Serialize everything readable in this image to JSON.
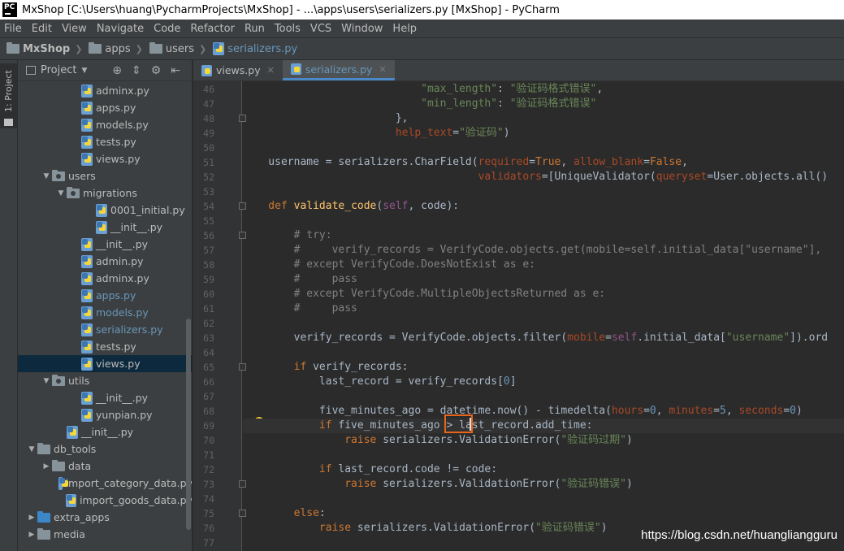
{
  "window": {
    "title": "MxShop [C:\\Users\\huang\\PycharmProjects\\MxShop] - ...\\apps\\users\\serializers.py [MxShop] - PyCharm",
    "logo_text": "PC"
  },
  "menu": [
    "File",
    "Edit",
    "View",
    "Navigate",
    "Code",
    "Refactor",
    "Run",
    "Tools",
    "VCS",
    "Window",
    "Help"
  ],
  "breadcrumb": [
    "MxShop",
    "apps",
    "users",
    "serializers.py"
  ],
  "toolwindow": {
    "label": "1: Project"
  },
  "project_panel": {
    "header": "Project",
    "icons": [
      "target-icon",
      "collapse-icon",
      "gear-icon",
      "hide-icon"
    ],
    "tree": [
      {
        "label": "adminx.py",
        "depth": 4,
        "type": "file"
      },
      {
        "label": "apps.py",
        "depth": 4,
        "type": "file"
      },
      {
        "label": "models.py",
        "depth": 4,
        "type": "file"
      },
      {
        "label": "tests.py",
        "depth": 4,
        "type": "file"
      },
      {
        "label": "views.py",
        "depth": 4,
        "type": "file"
      },
      {
        "label": "users",
        "depth": 2,
        "type": "package",
        "expanded": true
      },
      {
        "label": "migrations",
        "depth": 3,
        "type": "package",
        "expanded": true
      },
      {
        "label": "0001_initial.py",
        "depth": 5,
        "type": "file"
      },
      {
        "label": "__init__.py",
        "depth": 5,
        "type": "file"
      },
      {
        "label": "__init__.py",
        "depth": 4,
        "type": "file"
      },
      {
        "label": "admin.py",
        "depth": 4,
        "type": "file"
      },
      {
        "label": "adminx.py",
        "depth": 4,
        "type": "file"
      },
      {
        "label": "apps.py",
        "depth": 4,
        "type": "file",
        "modified": true
      },
      {
        "label": "models.py",
        "depth": 4,
        "type": "file",
        "modified": true
      },
      {
        "label": "serializers.py",
        "depth": 4,
        "type": "file",
        "modified": true
      },
      {
        "label": "tests.py",
        "depth": 4,
        "type": "file"
      },
      {
        "label": "views.py",
        "depth": 4,
        "type": "file",
        "selected": true
      },
      {
        "label": "utils",
        "depth": 2,
        "type": "package",
        "expanded": true
      },
      {
        "label": "__init__.py",
        "depth": 4,
        "type": "file"
      },
      {
        "label": "yunpian.py",
        "depth": 4,
        "type": "file"
      },
      {
        "label": "__init__.py",
        "depth": 3,
        "type": "file"
      },
      {
        "label": "db_tools",
        "depth": 1,
        "type": "folder",
        "expanded": true
      },
      {
        "label": "data",
        "depth": 2,
        "type": "folder",
        "expanded": false
      },
      {
        "label": "import_category_data.py",
        "depth": 3,
        "type": "file"
      },
      {
        "label": "import_goods_data.py",
        "depth": 3,
        "type": "file"
      },
      {
        "label": "extra_apps",
        "depth": 1,
        "type": "source-folder",
        "expanded": false
      },
      {
        "label": "media",
        "depth": 1,
        "type": "folder",
        "expanded": false
      }
    ]
  },
  "tabs": [
    {
      "label": "views.py",
      "active": false
    },
    {
      "label": "serializers.py",
      "active": true
    }
  ],
  "editor": {
    "line_numbers": [
      "46",
      "47",
      "48",
      "49",
      "50",
      "51",
      "52",
      "53",
      "54",
      "55",
      "56",
      "57",
      "58",
      "59",
      "60",
      "61",
      "62",
      "63",
      "64",
      "65",
      "66",
      "67",
      "68",
      "69",
      "70",
      "71",
      "72",
      "73",
      "74",
      "75",
      "76",
      "77"
    ],
    "lines": [
      [
        {
          "c": "str",
          "t": "                            \"max_length\""
        },
        {
          "c": "",
          "t": ": "
        },
        {
          "c": "str",
          "t": "\"验证码格式错误\""
        },
        {
          "c": "",
          "t": ","
        }
      ],
      [
        {
          "c": "str",
          "t": "                            \"min_length\""
        },
        {
          "c": "",
          "t": ": "
        },
        {
          "c": "str",
          "t": "\"验证码格式错误\""
        }
      ],
      [
        {
          "c": "",
          "t": "                        },"
        }
      ],
      [
        {
          "c": "prm",
          "t": "                        help_text"
        },
        {
          "c": "",
          "t": "="
        },
        {
          "c": "str",
          "t": "\"验证码\""
        },
        {
          "c": "",
          "t": ")"
        }
      ],
      [
        {
          "c": "",
          "t": ""
        }
      ],
      [
        {
          "c": "",
          "t": "    username = serializers.CharField("
        },
        {
          "c": "prm",
          "t": "required"
        },
        {
          "c": "",
          "t": "="
        },
        {
          "c": "kw",
          "t": "True"
        },
        {
          "c": "",
          "t": ", "
        },
        {
          "c": "prm",
          "t": "allow_blank"
        },
        {
          "c": "",
          "t": "="
        },
        {
          "c": "kw",
          "t": "False"
        },
        {
          "c": "",
          "t": ","
        }
      ],
      [
        {
          "c": "prm",
          "t": "                                     validators"
        },
        {
          "c": "",
          "t": "=[UniqueValidator("
        },
        {
          "c": "prm",
          "t": "queryset"
        },
        {
          "c": "",
          "t": "=User.objects.all()"
        }
      ],
      [
        {
          "c": "",
          "t": ""
        }
      ],
      [
        {
          "c": "kw",
          "t": "    def "
        },
        {
          "c": "fn",
          "t": "validate_code"
        },
        {
          "c": "",
          "t": "("
        },
        {
          "c": "slf",
          "t": "self"
        },
        {
          "c": "",
          "t": ", code):"
        }
      ],
      [
        {
          "c": "",
          "t": ""
        }
      ],
      [
        {
          "c": "cmt",
          "t": "        # try:"
        }
      ],
      [
        {
          "c": "cmt",
          "t": "        #     verify_records = VerifyCode.objects.get(mobile=self.initial_data[\"username\"],"
        }
      ],
      [
        {
          "c": "cmt",
          "t": "        # except VerifyCode.DoesNotExist as e:"
        }
      ],
      [
        {
          "c": "cmt",
          "t": "        #     pass"
        }
      ],
      [
        {
          "c": "cmt",
          "t": "        # except VerifyCode.MultipleObjectsReturned as e:"
        }
      ],
      [
        {
          "c": "cmt",
          "t": "        #     pass"
        }
      ],
      [
        {
          "c": "",
          "t": ""
        }
      ],
      [
        {
          "c": "",
          "t": "        verify_records = VerifyCode.objects.filter("
        },
        {
          "c": "prm",
          "t": "mobile"
        },
        {
          "c": "",
          "t": "="
        },
        {
          "c": "slf",
          "t": "self"
        },
        {
          "c": "",
          "t": ".initial_data["
        },
        {
          "c": "str",
          "t": "\"username\""
        },
        {
          "c": "",
          "t": "]).ord"
        }
      ],
      [
        {
          "c": "",
          "t": ""
        }
      ],
      [
        {
          "c": "kw",
          "t": "        if "
        },
        {
          "c": "",
          "t": "verify_records:"
        }
      ],
      [
        {
          "c": "",
          "t": "            last_record = verify_records["
        },
        {
          "c": "num",
          "t": "0"
        },
        {
          "c": "",
          "t": "]"
        }
      ],
      [
        {
          "c": "",
          "t": ""
        }
      ],
      [
        {
          "c": "",
          "t": "            five_minutes_ago = datetime.now() - timedelta("
        },
        {
          "c": "prm",
          "t": "hours"
        },
        {
          "c": "",
          "t": "="
        },
        {
          "c": "num",
          "t": "0"
        },
        {
          "c": "",
          "t": ", "
        },
        {
          "c": "prm",
          "t": "minutes"
        },
        {
          "c": "",
          "t": "="
        },
        {
          "c": "num",
          "t": "5"
        },
        {
          "c": "",
          "t": ", "
        },
        {
          "c": "prm",
          "t": "seconds"
        },
        {
          "c": "",
          "t": "="
        },
        {
          "c": "num",
          "t": "0"
        },
        {
          "c": "",
          "t": ")"
        }
      ],
      [
        {
          "c": "kw",
          "t": "            if "
        },
        {
          "c": "",
          "t": "five_minutes_ago > last_record.add_time:"
        }
      ],
      [
        {
          "c": "kw",
          "t": "                raise "
        },
        {
          "c": "",
          "t": "serializers.ValidationError("
        },
        {
          "c": "str",
          "t": "\"验证码过期\""
        },
        {
          "c": "",
          "t": ")"
        }
      ],
      [
        {
          "c": "",
          "t": ""
        }
      ],
      [
        {
          "c": "kw",
          "t": "            if "
        },
        {
          "c": "",
          "t": "last_record.code != code:"
        }
      ],
      [
        {
          "c": "kw",
          "t": "                raise "
        },
        {
          "c": "",
          "t": "serializers.ValidationError("
        },
        {
          "c": "str",
          "t": "\"验证码错误\""
        },
        {
          "c": "",
          "t": ")"
        }
      ],
      [
        {
          "c": "",
          "t": ""
        }
      ],
      [
        {
          "c": "kw",
          "t": "        else"
        },
        {
          "c": "",
          "t": ":"
        }
      ],
      [
        {
          "c": "kw",
          "t": "            raise "
        },
        {
          "c": "",
          "t": "serializers.ValidationError("
        },
        {
          "c": "str",
          "t": "\"验证码错误\""
        },
        {
          "c": "",
          "t": ")"
        }
      ],
      [
        {
          "c": "",
          "t": ""
        }
      ]
    ],
    "current_line": "69"
  },
  "watermark": "https://blog.csdn.net/huangliangguru",
  "colors": {
    "editor_bg": "#2b2b2b",
    "keyword": "#cc7832",
    "string": "#6a8759",
    "number": "#6897bb",
    "param": "#aa4926",
    "self": "#94558d",
    "function": "#ffc66d",
    "comment": "#808080",
    "highlight_box": "#e8641b"
  }
}
